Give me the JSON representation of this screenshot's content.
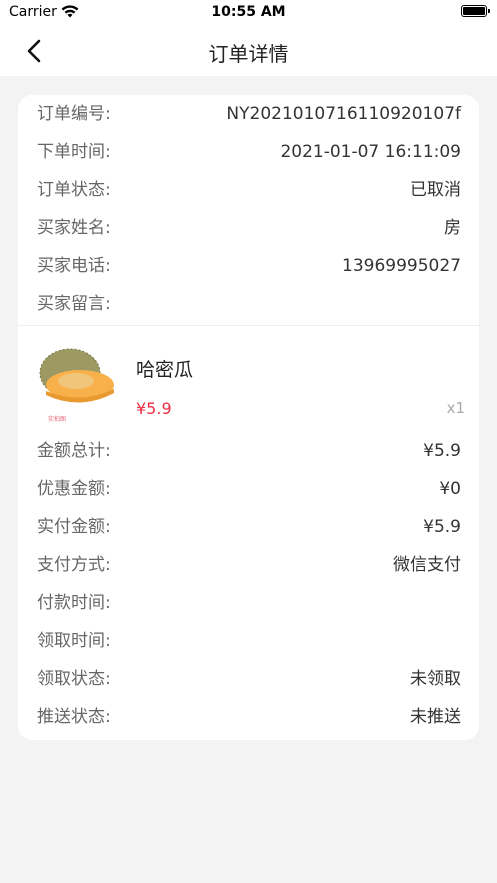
{
  "status_bar": {
    "carrier": "Carrier",
    "time": "10:55 AM"
  },
  "nav": {
    "title": "订单详情"
  },
  "order": [
    {
      "label": "订单编号:",
      "value": "NY202101071611092010​7f"
    },
    {
      "label": "下单时间:",
      "value": "2021-01-07 16:11:09"
    },
    {
      "label": "订单状态:",
      "value": "已取消"
    },
    {
      "label": "买家姓名:",
      "value": "房"
    },
    {
      "label": "买家电话:",
      "value": "13969995027"
    },
    {
      "label": "买家留言:",
      "value": ""
    }
  ],
  "product": {
    "name": "哈密瓜",
    "price": "¥5.9",
    "qty": "x1",
    "image_icon": "melon-image"
  },
  "payment": [
    {
      "label": "金额总计:",
      "value": "¥5.9"
    },
    {
      "label": "优惠金额:",
      "value": "¥0"
    },
    {
      "label": "实付金额:",
      "value": "¥5.9"
    },
    {
      "label": "支付方式:",
      "value": "微信支付"
    },
    {
      "label": "付款时间:",
      "value": ""
    },
    {
      "label": "领取时间:",
      "value": ""
    },
    {
      "label": "领取状态:",
      "value": "未领取"
    },
    {
      "label": "推送状态:",
      "value": "未推送"
    }
  ],
  "colors": {
    "price": "#f02d46",
    "background": "#f3f3f3",
    "card": "#ffffff"
  }
}
